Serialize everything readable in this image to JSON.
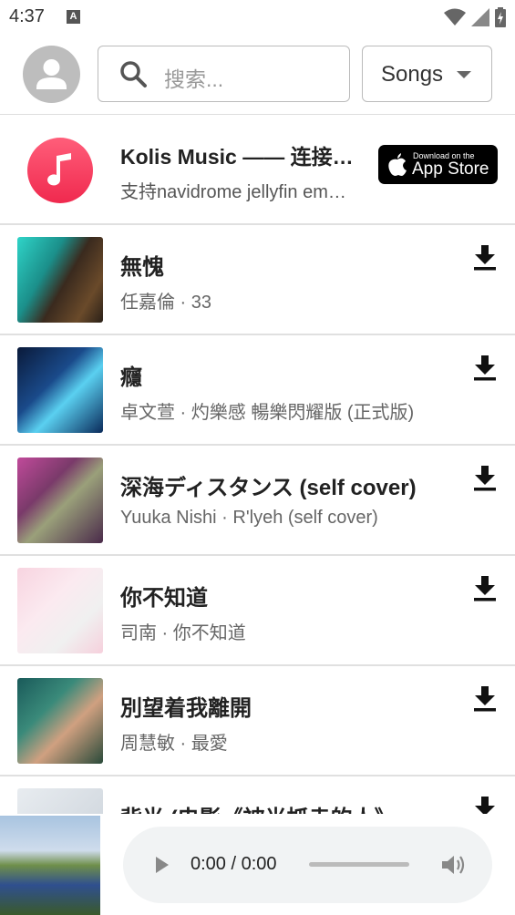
{
  "status_bar": {
    "time": "4:37",
    "notification_letter": "A"
  },
  "header": {
    "search_placeholder": "搜索...",
    "filter_value": "Songs"
  },
  "promo": {
    "title": "Kolis Music ―― 连接navidrome jellyfin emby",
    "subtitle": "支持navidrome jellyfin emby 等多种音乐服务",
    "badge_small": "Download on the",
    "badge_large": "App Store"
  },
  "songs": [
    {
      "title": "無愧",
      "meta": "任嘉倫 · 33"
    },
    {
      "title": "癮",
      "meta": "卓文萱 · 灼樂感 暢樂閃耀版 (正式版)"
    },
    {
      "title": "深海ディスタンス (self cover) ",
      "meta": "Yuuka Nishi · R'lyeh (self cover)"
    },
    {
      "title": "你不知道",
      "meta": "司南 · 你不知道"
    },
    {
      "title": "別望着我離開",
      "meta": "周慧敏 · 最愛"
    },
    {
      "title": "背光 (电影《被光抓走的人》",
      "meta": ""
    }
  ],
  "player": {
    "time": "0:00 / 0:00"
  }
}
